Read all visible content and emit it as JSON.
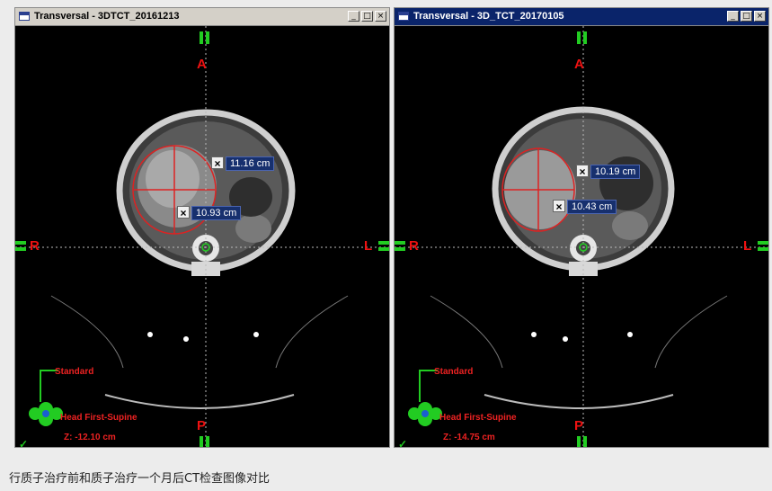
{
  "panels": [
    {
      "title": "Transversal - 3DTCT_20161213",
      "measurement_1": "11.16 cm",
      "measurement_2": "10.93 cm",
      "patient_position": "Head First-Supine",
      "z_position": "Z: -12.10 cm",
      "orientation_standard": "Standard"
    },
    {
      "title": "Transversal - 3D_TCT_20170105",
      "measurement_1": "10.19 cm",
      "measurement_2": "10.43 cm",
      "patient_position": "Head First-Supine",
      "z_position": "Z: -14.75 cm",
      "orientation_standard": "Standard"
    }
  ],
  "orientation": {
    "anterior": "A",
    "posterior": "P",
    "right": "R",
    "left": "L"
  },
  "window_buttons": {
    "minimize": "_",
    "maximize": "□",
    "close": "×"
  },
  "delete_marker": "×",
  "check_mark": "✓",
  "caption": "行质子治疗前和质子治疗一个月后CT检查图像对比",
  "colors": {
    "orientation": "#ee1111",
    "measure_box": "#17306e",
    "marker_green": "#22cc22",
    "roi_red": "#dd2222"
  }
}
